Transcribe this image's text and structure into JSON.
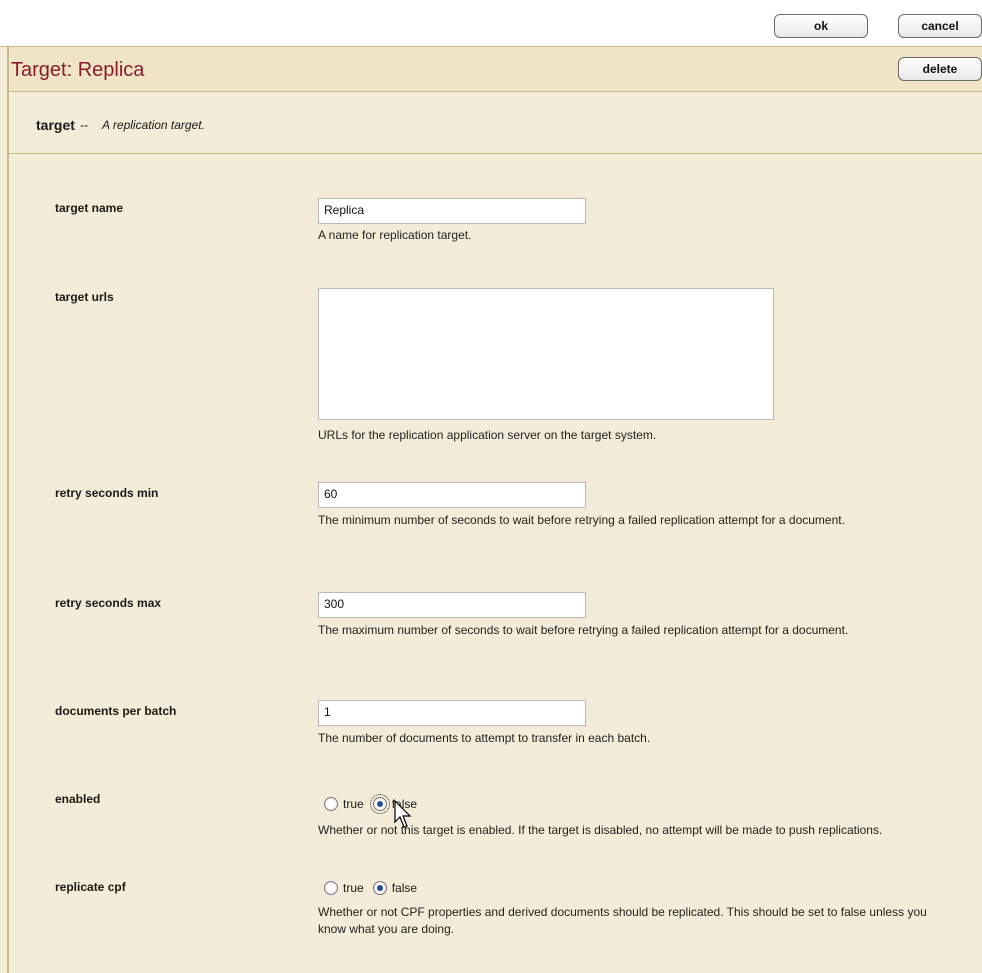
{
  "toolbar": {
    "ok_label": "ok",
    "cancel_label": "cancel",
    "delete_label": "delete"
  },
  "page": {
    "title": "Target: Replica"
  },
  "section": {
    "name": "target",
    "separator": " -- ",
    "description": "A replication target."
  },
  "fields": {
    "target_name": {
      "label": "target name",
      "value": "Replica",
      "help": "A name for replication target."
    },
    "target_urls": {
      "label": "target urls",
      "value": "",
      "help": "URLs for the replication application server on the target system."
    },
    "retry_min": {
      "label": "retry seconds min",
      "value": "60",
      "help": "The minimum number of seconds to wait before retrying a failed replication attempt for a document."
    },
    "retry_max": {
      "label": "retry seconds max",
      "value": "300",
      "help": "The maximum number of seconds to wait before retrying a failed replication attempt for a document."
    },
    "docs_per_batch": {
      "label": "documents per batch",
      "value": "1",
      "help": "The number of documents to attempt to transfer in each batch."
    },
    "enabled": {
      "label": "enabled",
      "true_label": "true",
      "false_label": "false",
      "selected": "false",
      "help": "Whether or not this target is enabled. If the target is disabled, no attempt will be made to push replications."
    },
    "replicate_cpf": {
      "label": "replicate cpf",
      "true_label": "true",
      "false_label": "false",
      "selected": "false",
      "help": "Whether or not CPF properties and derived documents should be replicated. This should be set to false unless you know what you are doing."
    }
  },
  "colors": {
    "title": "#8b1c2f",
    "panel": "#f3ecd8",
    "rule": "#cbb889"
  }
}
